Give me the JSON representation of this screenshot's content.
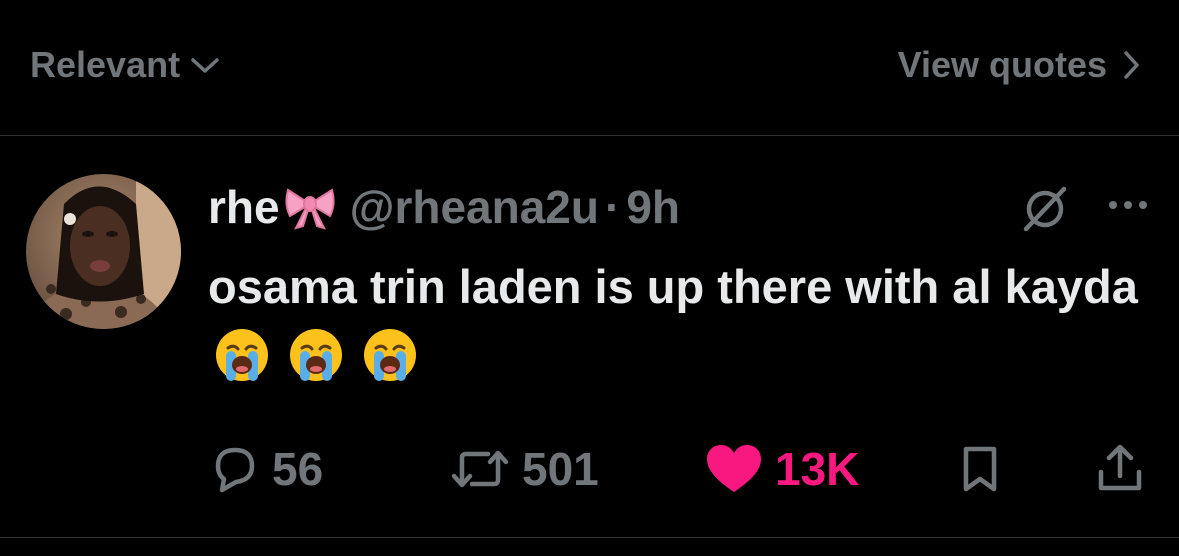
{
  "topbar": {
    "sort_label": "Relevant",
    "quotes_label": "View quotes"
  },
  "tweet": {
    "display_name": "rhe",
    "handle": "@rheana2u",
    "separator": "·",
    "time": "9h",
    "text": "osama trin laden is up there with al kayda",
    "emojis": [
      "loudly-crying-face",
      "loudly-crying-face",
      "loudly-crying-face"
    ]
  },
  "actions": {
    "replies": "56",
    "reposts": "501",
    "likes": "13K"
  },
  "colors": {
    "background": "#000000",
    "primary_text": "#e7e9ea",
    "secondary_text": "#71767b",
    "like": "#f91880",
    "divider": "#2f3336"
  },
  "icons": {
    "sort": "chevron-down-icon",
    "quotes": "chevron-right-icon",
    "grok": "grok-icon",
    "more": "more-dots-icon",
    "reply": "reply-icon",
    "repost": "repost-icon",
    "like": "heart-icon",
    "bookmark": "bookmark-icon",
    "share": "share-icon"
  }
}
